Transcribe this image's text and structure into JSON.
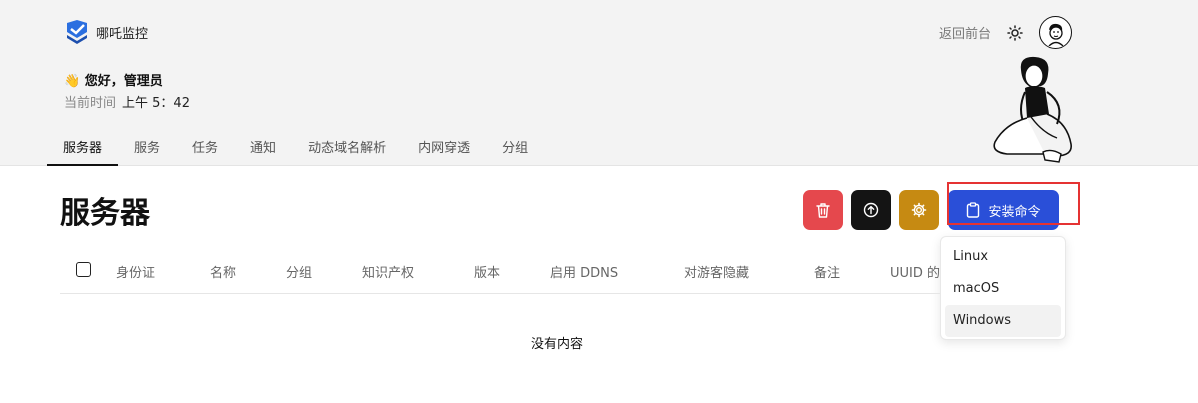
{
  "brand": {
    "name": "哪吒监控"
  },
  "header": {
    "back_label": "返回前台"
  },
  "greeting": {
    "text": "👋 您好，管理员",
    "time_label": "当前时间",
    "time_value": "上午 5：42"
  },
  "tabs": [
    {
      "label": "服务器",
      "active": true
    },
    {
      "label": "服务",
      "active": false
    },
    {
      "label": "任务",
      "active": false
    },
    {
      "label": "通知",
      "active": false
    },
    {
      "label": "动态域名解析",
      "active": false
    },
    {
      "label": "内网穿透",
      "active": false
    },
    {
      "label": "分组",
      "active": false
    }
  ],
  "page": {
    "title": "服务器"
  },
  "toolbar": {
    "install_label": "安装命令"
  },
  "dropdown": {
    "items": [
      "Linux",
      "macOS",
      "Windows"
    ],
    "hovered": "Windows"
  },
  "table": {
    "columns": [
      "身份证",
      "名称",
      "分组",
      "知识产权",
      "版本",
      "启用 DDNS",
      "对游客隐藏",
      "备注",
      "UUID 的"
    ],
    "empty_text": "没有内容"
  },
  "colors": {
    "delete": "#e5484d",
    "upgrade": "#141414",
    "config": "#c68a12",
    "install": "#2a4fd8",
    "highlight": "#e53333"
  }
}
